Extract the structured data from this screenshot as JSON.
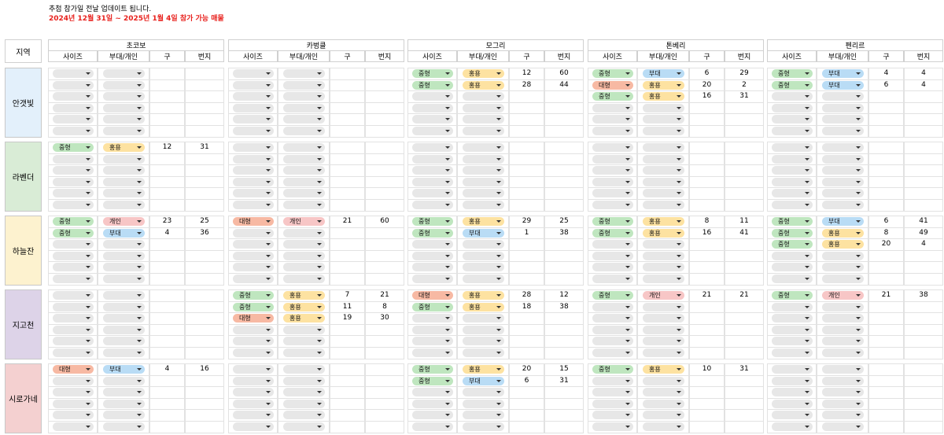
{
  "notice": {
    "line1": "추첨 참가일 전날 업데이트 됩니다.",
    "line2": "2024년 12월 31일 ~ 2025년 1월 4일 참가 가능 매물"
  },
  "header": {
    "region_label": "지역",
    "sub_columns": [
      "사이즈",
      "부대/개인",
      "구",
      "번지"
    ]
  },
  "groups": [
    "초코보",
    "카벙클",
    "모그리",
    "톤베리",
    "펜리르"
  ],
  "regions": [
    {
      "name": "안갯빛",
      "color": "#e3f0fb"
    },
    {
      "name": "라벤더",
      "color": "#d9ecd6"
    },
    {
      "name": "하늘잔",
      "color": "#fdf2cf"
    },
    {
      "name": "지고천",
      "color": "#ddd3e8"
    },
    {
      "name": "시로가네",
      "color": "#f4d0d0"
    }
  ],
  "chip_colors": {
    "중형": "#bfe6bf",
    "대형": "#f7b9a3",
    "홍용": "#fde2a1",
    "부대": "#b9dcf5",
    "개인": "#f7c6c6",
    "empty": "#e4e4e4"
  },
  "rows_per_region": 6,
  "listings": [
    {
      "region": 0,
      "group": 2,
      "row": 0,
      "size": "중형",
      "type": "홍용",
      "ward": "12",
      "plot": "60"
    },
    {
      "region": 0,
      "group": 2,
      "row": 1,
      "size": "중형",
      "type": "홍용",
      "ward": "28",
      "plot": "44"
    },
    {
      "region": 0,
      "group": 3,
      "row": 0,
      "size": "중형",
      "type": "부대",
      "ward": "6",
      "plot": "29"
    },
    {
      "region": 0,
      "group": 3,
      "row": 1,
      "size": "대형",
      "type": "홍용",
      "ward": "20",
      "plot": "2"
    },
    {
      "region": 0,
      "group": 3,
      "row": 2,
      "size": "중형",
      "type": "홍용",
      "ward": "16",
      "plot": "31"
    },
    {
      "region": 0,
      "group": 4,
      "row": 0,
      "size": "중형",
      "type": "부대",
      "ward": "4",
      "plot": "4"
    },
    {
      "region": 0,
      "group": 4,
      "row": 1,
      "size": "중형",
      "type": "부대",
      "ward": "6",
      "plot": "4"
    },
    {
      "region": 1,
      "group": 0,
      "row": 0,
      "size": "중형",
      "type": "홍용",
      "ward": "12",
      "plot": "31"
    },
    {
      "region": 2,
      "group": 0,
      "row": 0,
      "size": "중형",
      "type": "개인",
      "ward": "23",
      "plot": "25"
    },
    {
      "region": 2,
      "group": 0,
      "row": 1,
      "size": "중형",
      "type": "부대",
      "ward": "4",
      "plot": "36"
    },
    {
      "region": 2,
      "group": 1,
      "row": 0,
      "size": "대형",
      "type": "개인",
      "ward": "21",
      "plot": "60"
    },
    {
      "region": 2,
      "group": 2,
      "row": 0,
      "size": "중형",
      "type": "홍용",
      "ward": "29",
      "plot": "25"
    },
    {
      "region": 2,
      "group": 2,
      "row": 1,
      "size": "중형",
      "type": "부대",
      "ward": "1",
      "plot": "38"
    },
    {
      "region": 2,
      "group": 3,
      "row": 0,
      "size": "중형",
      "type": "홍용",
      "ward": "8",
      "plot": "11"
    },
    {
      "region": 2,
      "group": 3,
      "row": 1,
      "size": "중형",
      "type": "홍용",
      "ward": "16",
      "plot": "41"
    },
    {
      "region": 2,
      "group": 4,
      "row": 0,
      "size": "중형",
      "type": "부대",
      "ward": "6",
      "plot": "41"
    },
    {
      "region": 2,
      "group": 4,
      "row": 1,
      "size": "중형",
      "type": "홍용",
      "ward": "8",
      "plot": "49"
    },
    {
      "region": 2,
      "group": 4,
      "row": 2,
      "size": "중형",
      "type": "홍용",
      "ward": "20",
      "plot": "4"
    },
    {
      "region": 3,
      "group": 1,
      "row": 0,
      "size": "중형",
      "type": "홍용",
      "ward": "7",
      "plot": "21"
    },
    {
      "region": 3,
      "group": 1,
      "row": 1,
      "size": "중형",
      "type": "홍용",
      "ward": "11",
      "plot": "8"
    },
    {
      "region": 3,
      "group": 1,
      "row": 2,
      "size": "대형",
      "type": "홍용",
      "ward": "19",
      "plot": "30"
    },
    {
      "region": 3,
      "group": 2,
      "row": 0,
      "size": "대형",
      "type": "홍용",
      "ward": "28",
      "plot": "12"
    },
    {
      "region": 3,
      "group": 2,
      "row": 1,
      "size": "중형",
      "type": "홍용",
      "ward": "18",
      "plot": "38"
    },
    {
      "region": 3,
      "group": 3,
      "row": 0,
      "size": "중형",
      "type": "개인",
      "ward": "21",
      "plot": "21"
    },
    {
      "region": 3,
      "group": 4,
      "row": 0,
      "size": "중형",
      "type": "개인",
      "ward": "21",
      "plot": "38"
    },
    {
      "region": 4,
      "group": 0,
      "row": 0,
      "size": "대형",
      "type": "부대",
      "ward": "4",
      "plot": "16"
    },
    {
      "region": 4,
      "group": 2,
      "row": 0,
      "size": "중형",
      "type": "홍용",
      "ward": "20",
      "plot": "15"
    },
    {
      "region": 4,
      "group": 2,
      "row": 1,
      "size": "중형",
      "type": "부대",
      "ward": "6",
      "plot": "31"
    },
    {
      "region": 4,
      "group": 3,
      "row": 0,
      "size": "중형",
      "type": "홍용",
      "ward": "10",
      "plot": "31"
    }
  ]
}
